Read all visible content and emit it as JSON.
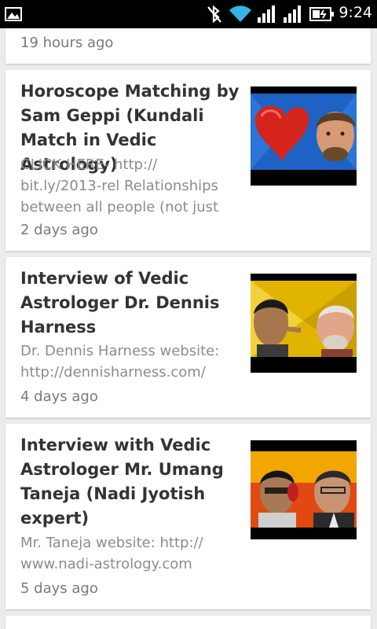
{
  "status_bar": {
    "time": "9:24",
    "icons": [
      "image-icon",
      "bluetooth-off-icon",
      "wifi-icon",
      "signal-icon",
      "signal-icon",
      "battery-icon"
    ]
  },
  "feed": {
    "items": [
      {
        "age": "19 hours ago"
      },
      {
        "title": "Horoscope Matching by Sam Geppi (Kundali Match in Vedic Astrology)",
        "description": "CLICK HERE- http://\nbit.ly/2013-rel Relationships\nbetween all people (not just",
        "age": "2 days ago"
      },
      {
        "title": "Interview of Vedic Astrologer Dr. Dennis Harness",
        "description": "Dr. Dennis Harness website:\nhttp://dennisharness.com/",
        "age": "4 days ago"
      },
      {
        "title": "Interview with Vedic Astrologer Mr. Umang Taneja (Nadi Jyotish expert)",
        "description": "Mr. Taneja website: http://\nwww.nadi-astrology.com",
        "age": "5 days ago"
      }
    ]
  }
}
